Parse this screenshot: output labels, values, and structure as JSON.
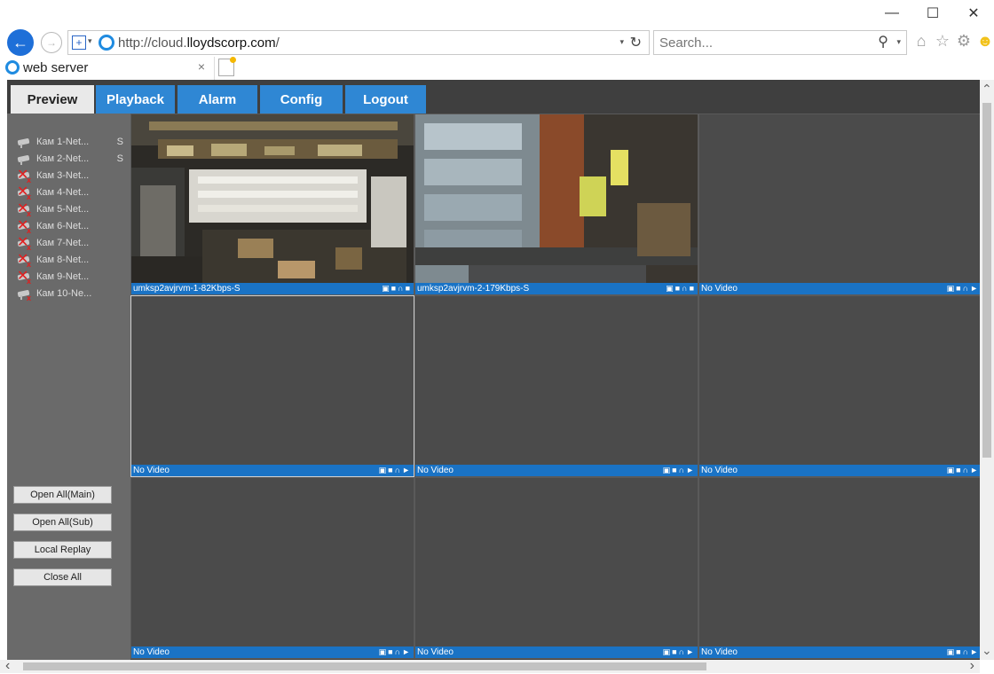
{
  "window": {
    "minimize": "—",
    "maximize": "☐",
    "close": "✕"
  },
  "address_bar": {
    "url_prefix": "http://cloud.",
    "url_domain": "lloydscorp.com",
    "url_suffix": "/",
    "search_placeholder": "Search..."
  },
  "tab": {
    "title": "web server",
    "close": "×"
  },
  "nav": [
    {
      "label": "Preview",
      "active": true
    },
    {
      "label": "Playback",
      "active": false
    },
    {
      "label": "Alarm",
      "active": false
    },
    {
      "label": "Config",
      "active": false
    },
    {
      "label": "Logout",
      "active": false
    }
  ],
  "cameras": [
    {
      "label": "Кам 1-Net...",
      "suffix": "S",
      "status": "online"
    },
    {
      "label": "Кам 2-Net...",
      "suffix": "S",
      "status": "online"
    },
    {
      "label": "Кам 3-Net...",
      "suffix": "",
      "status": "offline"
    },
    {
      "label": "Кам 4-Net...",
      "suffix": "",
      "status": "offline"
    },
    {
      "label": "Кам 5-Net...",
      "suffix": "",
      "status": "offline"
    },
    {
      "label": "Кам 6-Net...",
      "suffix": "",
      "status": "offline"
    },
    {
      "label": "Кам 7-Net...",
      "suffix": "",
      "status": "offline"
    },
    {
      "label": "Кам 8-Net...",
      "suffix": "",
      "status": "offline"
    },
    {
      "label": "Кам 9-Net...",
      "suffix": "",
      "status": "offline"
    },
    {
      "label": "Кам 10-Ne...",
      "suffix": "",
      "status": "online-x"
    }
  ],
  "side_buttons": [
    "Open All(Main)",
    "Open All(Sub)",
    "Local Replay",
    "Close All"
  ],
  "cells": [
    {
      "label": "umksp2avjrvm-1-82Kbps-S",
      "video": "cam1"
    },
    {
      "label": "umksp2avjrvm-2-179Kbps-S",
      "video": "cam2"
    },
    {
      "label": "No Video",
      "video": ""
    },
    {
      "label": "No Video",
      "video": ""
    },
    {
      "label": "No Video",
      "video": ""
    },
    {
      "label": "No Video",
      "video": ""
    },
    {
      "label": "No Video",
      "video": ""
    },
    {
      "label": "No Video",
      "video": ""
    },
    {
      "label": "No Video",
      "video": ""
    }
  ],
  "colors": {
    "accent": "#2f87d4",
    "bar": "#1a73c5",
    "page_bg": "#3f3f3f",
    "sidebar_bg": "#6a6a6a"
  }
}
